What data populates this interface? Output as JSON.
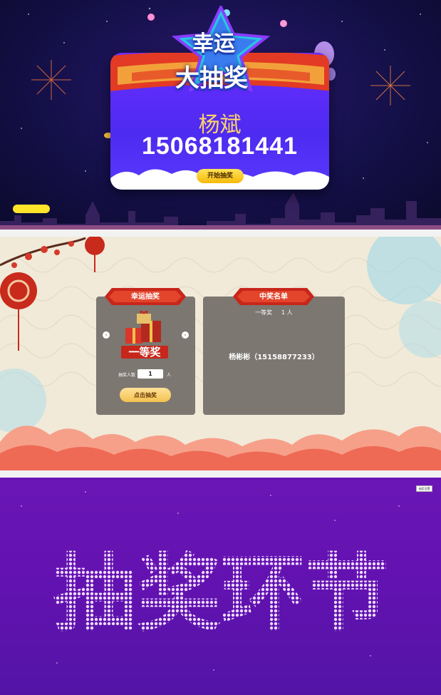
{
  "panel1": {
    "title_line1": "幸运",
    "title_line2": "大抽奖",
    "winner_name": "杨斌",
    "winner_phone": "15068181441",
    "start_button": "开始抽奖",
    "colors": {
      "card": "#5a2ff5",
      "name": "#ffd36a",
      "button": "#f6b90a"
    }
  },
  "panel2": {
    "left_title": "幸运抽奖",
    "right_title": "中奖名单",
    "prize_label": "一等奖",
    "prev_arrow": "‹",
    "next_arrow": "›",
    "count_label": "抽奖人数",
    "count_value": "1",
    "count_unit": "人",
    "draw_button": "点击抽奖",
    "result_level": "一等奖",
    "result_count": "1 人",
    "winner_entry": "杨彬彬（15158877233）"
  },
  "panel3": {
    "settings_button": "抽奖设置",
    "big_text": "抽奖环节"
  }
}
